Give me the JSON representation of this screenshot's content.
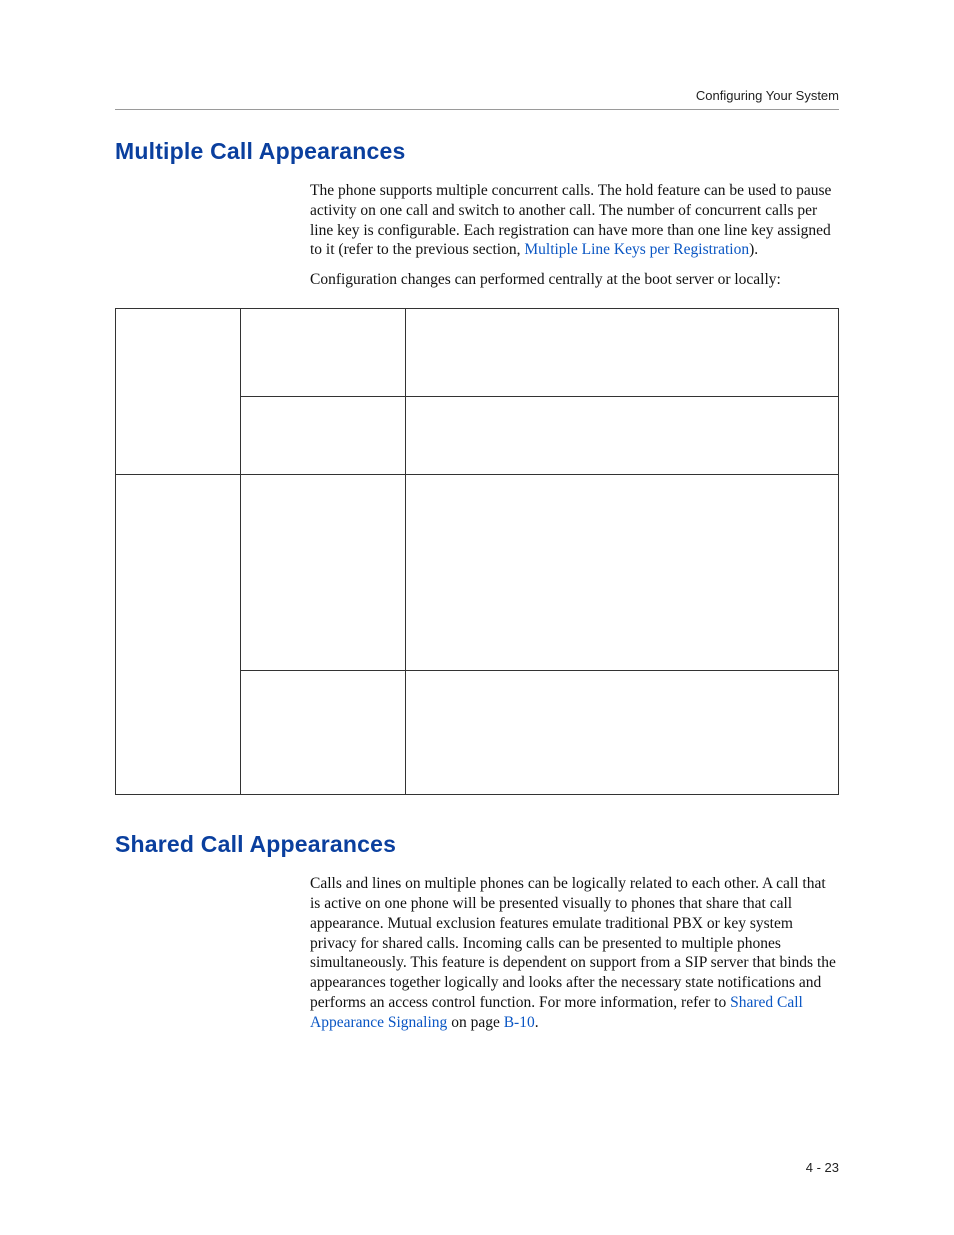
{
  "runningHead": "Configuring Your System",
  "section1": {
    "title": "Multiple Call Appearances",
    "para1_pre": "The phone supports multiple concurrent calls. The hold feature can be used to pause activity on one call and switch to another call. The number of concurrent calls per line key is configurable. Each registration can have more than one line key assigned to it (refer to the previous section, ",
    "para1_link": "Multiple Line Keys per Registration",
    "para1_post": ").",
    "para2": "Configuration changes can performed centrally at the boot server or locally:",
    "table": {
      "rows": [
        {
          "c0": "",
          "c1": "",
          "c2": ""
        },
        {
          "c0": "",
          "c1": "",
          "c2": ""
        },
        {
          "c0": "",
          "c1": "",
          "c2": ""
        },
        {
          "c0": "",
          "c1": "",
          "c2": ""
        }
      ],
      "rowHeights": [
        "88px",
        "78px",
        "196px",
        "124px"
      ]
    }
  },
  "section2": {
    "title": "Shared Call Appearances",
    "para1_pre": "Calls and lines on multiple phones can be logically related to each other. A call that is active on one phone will be presented visually to phones that share that call appearance. Mutual exclusion features emulate traditional PBX or key system privacy for shared calls. Incoming calls can be presented to multiple phones simultaneously. This feature is dependent on support from a SIP server that binds the appearances together logically and looks after the necessary state notifications and performs an access control function. For more information, refer to ",
    "para1_link1": "Shared Call Appearance Signaling",
    "para1_mid": " on page ",
    "para1_link2": "B-10",
    "para1_post": "."
  },
  "pageNumber": "4 - 23"
}
